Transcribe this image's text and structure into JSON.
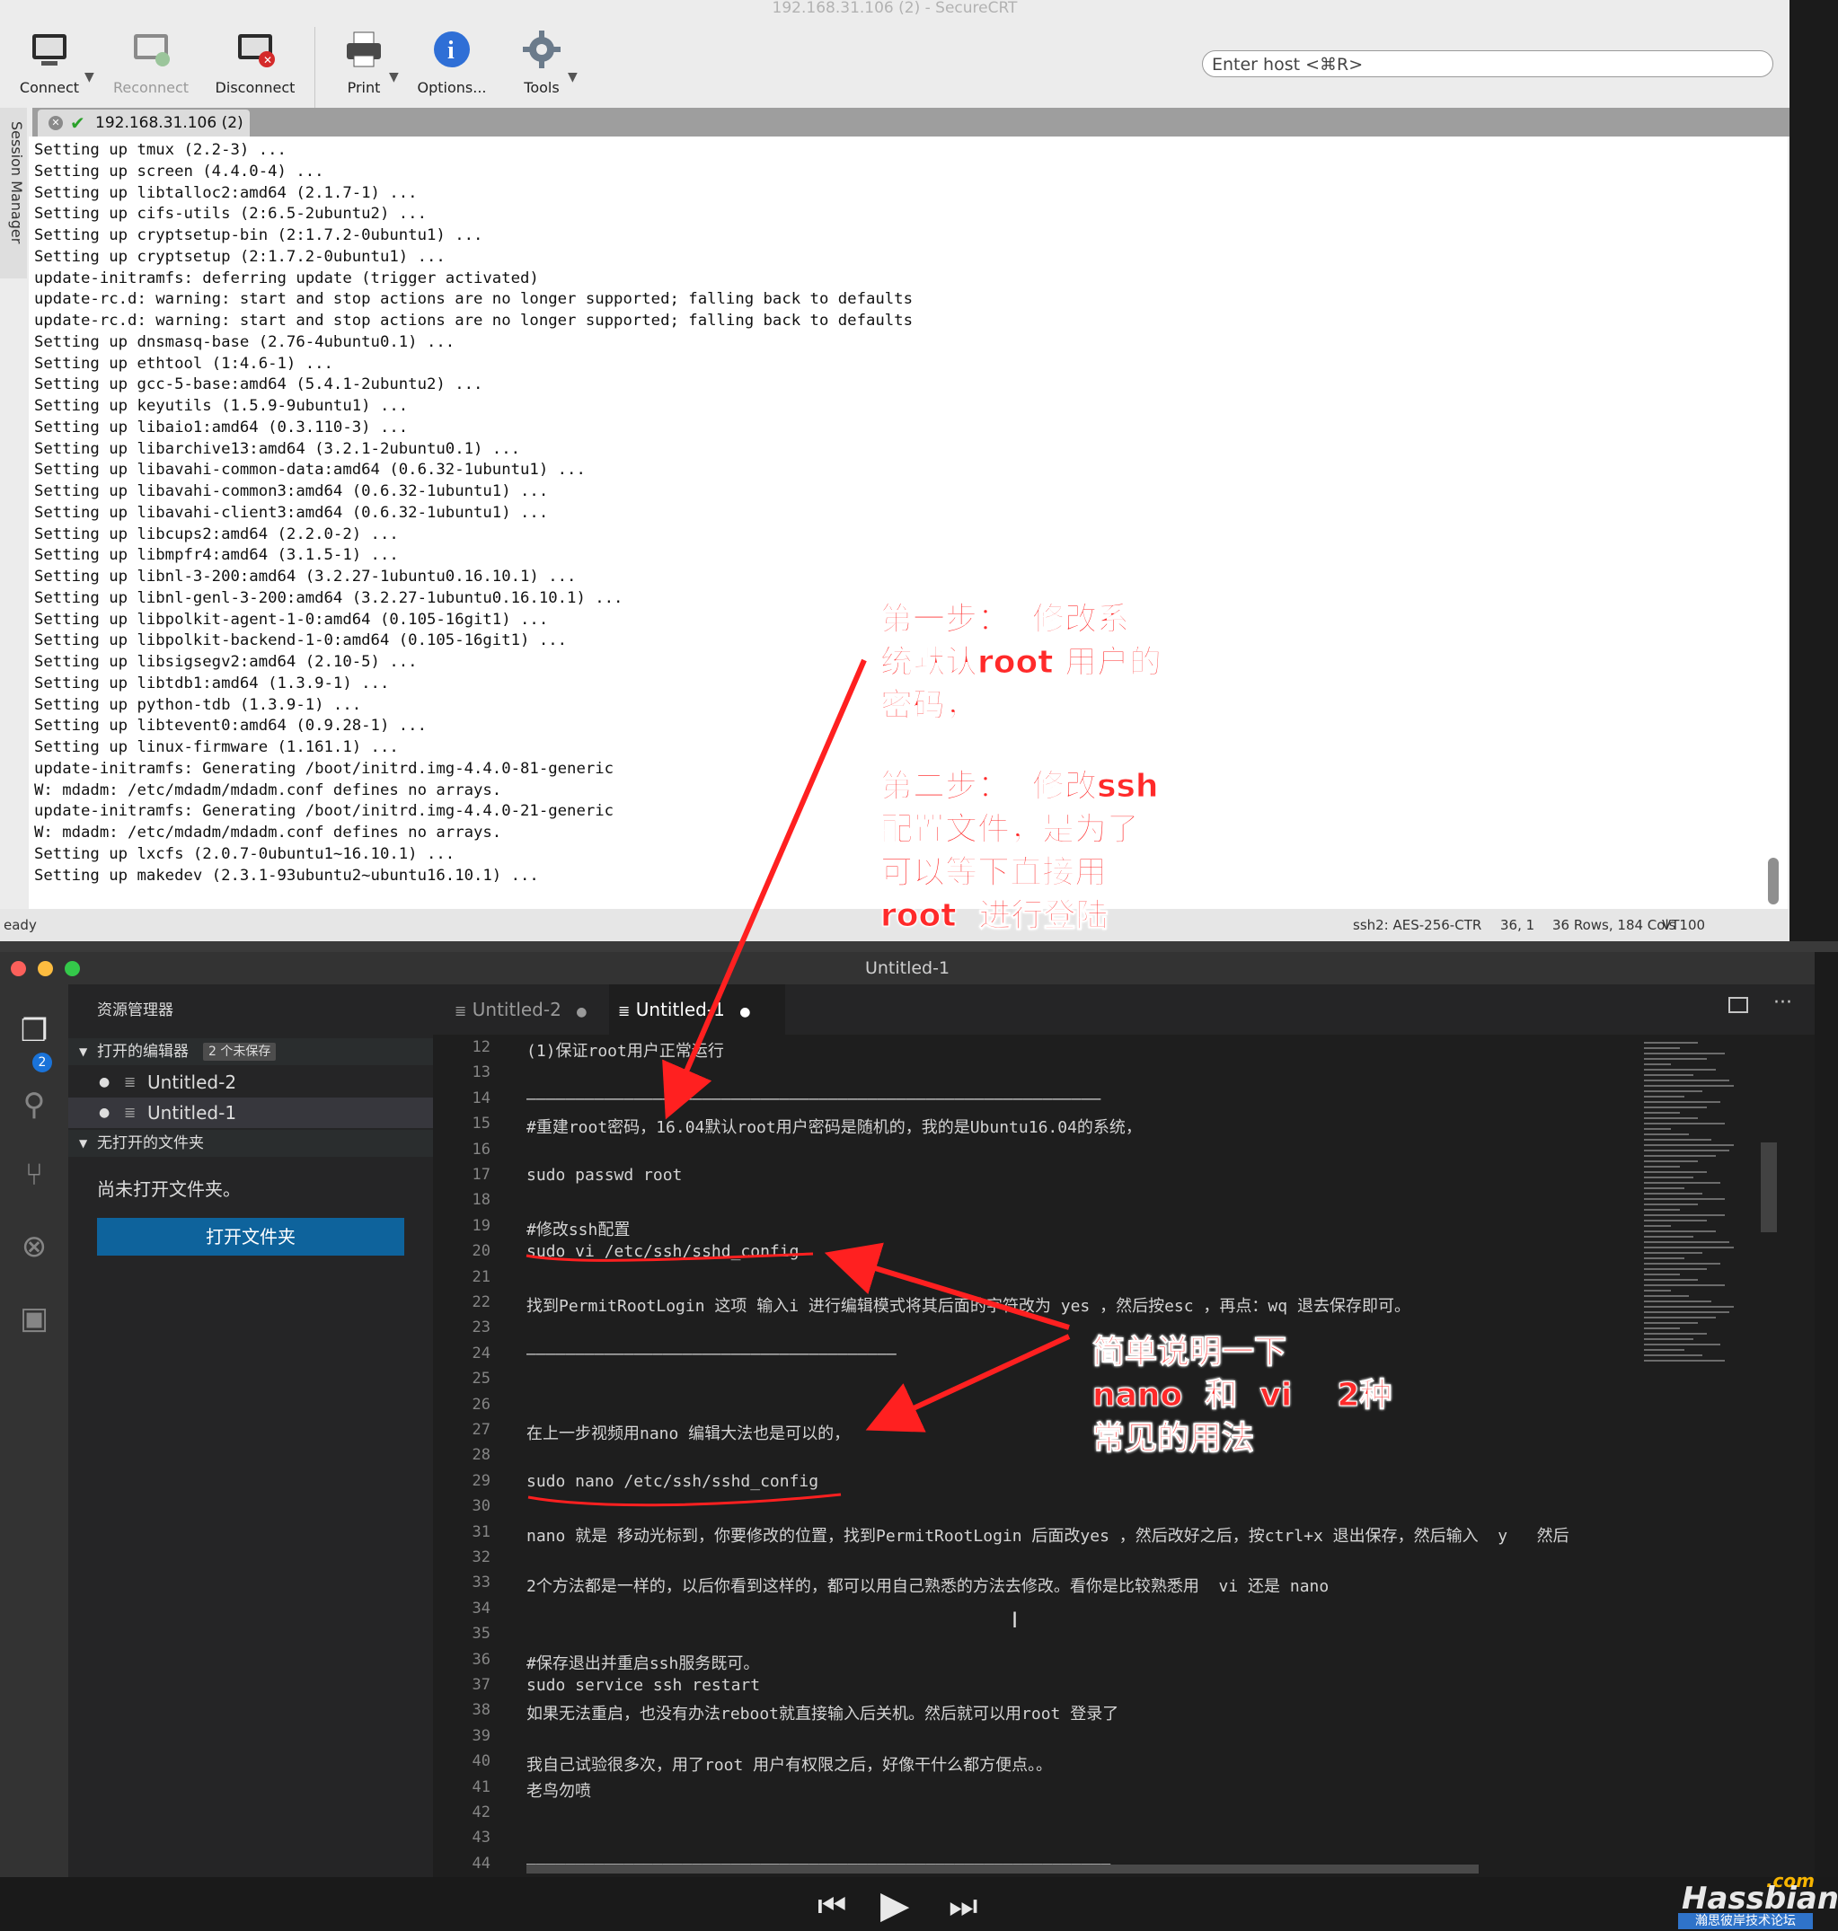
{
  "crt": {
    "window_title": "192.168.31.106 (2) - SecureCRT",
    "toolbar": {
      "connect": "Connect",
      "reconnect": "Reconnect",
      "disconnect": "Disconnect",
      "print": "Print",
      "options": "Options...",
      "tools": "Tools"
    },
    "host_placeholder": "Enter host <⌘R>",
    "tab_label": "192.168.31.106 (2)",
    "session_manager": "Session Manager",
    "terminal_lines": [
      "Setting up tmux (2.2-3) ...",
      "Setting up screen (4.4.0-4) ...",
      "Setting up libtalloc2:amd64 (2.1.7-1) ...",
      "Setting up cifs-utils (2:6.5-2ubuntu2) ...",
      "Setting up cryptsetup-bin (2:1.7.2-0ubuntu1) ...",
      "Setting up cryptsetup (2:1.7.2-0ubuntu1) ...",
      "update-initramfs: deferring update (trigger activated)",
      "update-rc.d: warning: start and stop actions are no longer supported; falling back to defaults",
      "update-rc.d: warning: start and stop actions are no longer supported; falling back to defaults",
      "Setting up dnsmasq-base (2.76-4ubuntu0.1) ...",
      "Setting up ethtool (1:4.6-1) ...",
      "Setting up gcc-5-base:amd64 (5.4.1-2ubuntu2) ...",
      "Setting up keyutils (1.5.9-9ubuntu1) ...",
      "Setting up libaio1:amd64 (0.3.110-3) ...",
      "Setting up libarchive13:amd64 (3.2.1-2ubuntu0.1) ...",
      "Setting up libavahi-common-data:amd64 (0.6.32-1ubuntu1) ...",
      "Setting up libavahi-common3:amd64 (0.6.32-1ubuntu1) ...",
      "Setting up libavahi-client3:amd64 (0.6.32-1ubuntu1) ...",
      "Setting up libcups2:amd64 (2.2.0-2) ...",
      "Setting up libmpfr4:amd64 (3.1.5-1) ...",
      "Setting up libnl-3-200:amd64 (3.2.27-1ubuntu0.16.10.1) ...",
      "Setting up libnl-genl-3-200:amd64 (3.2.27-1ubuntu0.16.10.1) ...",
      "Setting up libpolkit-agent-1-0:amd64 (0.105-16git1) ...",
      "Setting up libpolkit-backend-1-0:amd64 (0.105-16git1) ...",
      "Setting up libsigsegv2:amd64 (2.10-5) ...",
      "Setting up libtdb1:amd64 (1.3.9-1) ...",
      "Setting up python-tdb (1.3.9-1) ...",
      "Setting up libtevent0:amd64 (0.9.28-1) ...",
      "Setting up linux-firmware (1.161.1) ...",
      "update-initramfs: Generating /boot/initrd.img-4.4.0-81-generic",
      "W: mdadm: /etc/mdadm/mdadm.conf defines no arrays.",
      "update-initramfs: Generating /boot/initrd.img-4.4.0-21-generic",
      "W: mdadm: /etc/mdadm/mdadm.conf defines no arrays.",
      "Setting up lxcfs (2.0.7-0ubuntu1~16.10.1) ...",
      "Setting up makedev (2.3.1-93ubuntu2~ubuntu16.10.1) ..."
    ],
    "status": {
      "left": "eady",
      "cipher": "ssh2: AES-256-CTR",
      "position": "36, 1",
      "size": "36 Rows, 184 Cols",
      "term": "VT100"
    }
  },
  "vscode": {
    "window_title": "Untitled-1",
    "badge": "2",
    "sidebar": {
      "title": "资源管理器",
      "open_editors": "打开的编辑器",
      "unsaved": "2 个未保存",
      "files": [
        "Untitled-2",
        "Untitled-1"
      ],
      "no_folder_header": "无打开的文件夹",
      "no_folder_text": "尚未打开文件夹。",
      "open_folder_button": "打开文件夹"
    },
    "tabs": [
      "Untitled-2",
      "Untitled-1"
    ],
    "lines": [
      {
        "n": "12",
        "text": "(1)保证root用户正常运行"
      },
      {
        "n": "13",
        "text": ""
      },
      {
        "n": "14",
        "text": "———————————————————————————————————————————————————————————"
      },
      {
        "n": "15",
        "text": "#重建root密码，16.04默认root用户密码是随机的，我的是Ubuntu16.04的系统，"
      },
      {
        "n": "16",
        "text": ""
      },
      {
        "n": "17",
        "text": "sudo passwd root"
      },
      {
        "n": "18",
        "text": ""
      },
      {
        "n": "19",
        "text": "#修改ssh配置"
      },
      {
        "n": "20",
        "text": "sudo vi /etc/ssh/sshd_config"
      },
      {
        "n": "21",
        "text": ""
      },
      {
        "n": "22",
        "text": "找到PermitRootLogin 这项 输入i 进行编辑模式将其后面的字符改为 yes ，然后按esc ，再点：wq 退去保存即可。"
      },
      {
        "n": "23",
        "text": ""
      },
      {
        "n": "24",
        "text": "——————————————————————————————————————"
      },
      {
        "n": "25",
        "text": ""
      },
      {
        "n": "26",
        "text": ""
      },
      {
        "n": "27",
        "text": "在上一步视频用nano 编辑大法也是可以的，"
      },
      {
        "n": "28",
        "text": ""
      },
      {
        "n": "29",
        "text": "sudo nano /etc/ssh/sshd_config"
      },
      {
        "n": "30",
        "text": ""
      },
      {
        "n": "31",
        "text": "nano 就是 移动光标到，你要修改的位置，找到PermitRootLogin 后面改yes ，然后改好之后，按ctrl+x 退出保存，然后输入  y   然后"
      },
      {
        "n": "32",
        "text": ""
      },
      {
        "n": "33",
        "text": "2个方法都是一样的，以后你看到这样的，都可以用自己熟悉的方法去修改。看你是比较熟悉用  vi 还是 nano"
      },
      {
        "n": "34",
        "text": ""
      },
      {
        "n": "35",
        "text": ""
      },
      {
        "n": "36",
        "text": "#保存退出并重启ssh服务既可。"
      },
      {
        "n": "37",
        "text": "sudo service ssh restart"
      },
      {
        "n": "38",
        "text": "如果无法重启，也没有办法reboot就直接输入后关机。然后就可以用root 登录了"
      },
      {
        "n": "39",
        "text": ""
      },
      {
        "n": "40",
        "text": "我自己试验很多次，用了root 用户有权限之后，好像干什么都方便点。。"
      },
      {
        "n": "41",
        "text": "老鸟勿喷"
      },
      {
        "n": "42",
        "text": ""
      },
      {
        "n": "43",
        "text": ""
      },
      {
        "n": "44",
        "text": "————————————————————————————————————————————————————————————"
      }
    ]
  },
  "annotations": {
    "note1": "第一步：  修改系\n统默认root 用户的\n密码，",
    "note2": "第二步：  修改ssh\n配置文件，是为了\n可以等下直接用\nroot  进行登陆",
    "note3": "简单说明一下\nnano  和  vi    2种\n常见的用法"
  },
  "watermark": {
    "brand": "Hassbian",
    "suffix": ".com",
    "sub": "瀚思彼岸技术论坛"
  },
  "colors": {
    "accent_blue": "#0e639c",
    "annotation_red": "#ff2a2a"
  }
}
